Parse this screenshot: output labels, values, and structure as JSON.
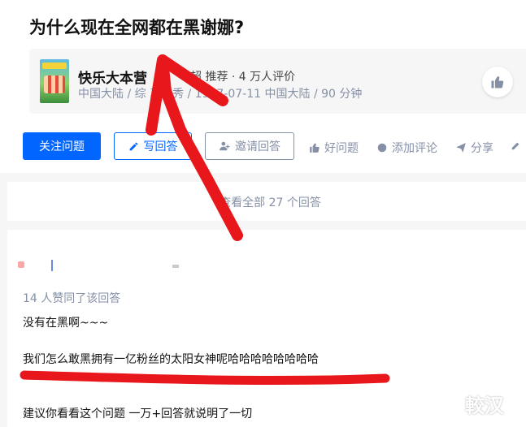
{
  "question": {
    "title": "为什么现在全网都在黑谢娜?"
  },
  "show_card": {
    "name": "快乐大本营",
    "recommend_text": "超 推荐 · 4 万人评价",
    "meta": "中国大陆 / 综 真人秀 / 1997-07-11 中国大陆 / 90 分钟",
    "poster_icon": "show-poster",
    "like_icon": "thumbs-up-icon"
  },
  "actions": {
    "follow_label": "关注问题",
    "write_label": "写回答",
    "invite_label": "邀请回答",
    "good_label": "好问题",
    "comment_label": "添加评论",
    "share_label": "分享"
  },
  "answers": {
    "view_all_label": "查看全部 27 个回答"
  },
  "answer": {
    "voters": "14 人赞同了该回答",
    "paragraphs": [
      "没有在黑啊~~~",
      "我们怎么敢黑拥有一亿粉丝的太阳女神呢哈哈哈哈哈哈哈哈",
      "建议你看看这个问题 一万+回答就说明了一切"
    ]
  },
  "watermark": {
    "text": "較汉"
  },
  "colors": {
    "accent": "#0066ff",
    "muted": "#8590a6",
    "annotation_red": "#e8171b"
  }
}
